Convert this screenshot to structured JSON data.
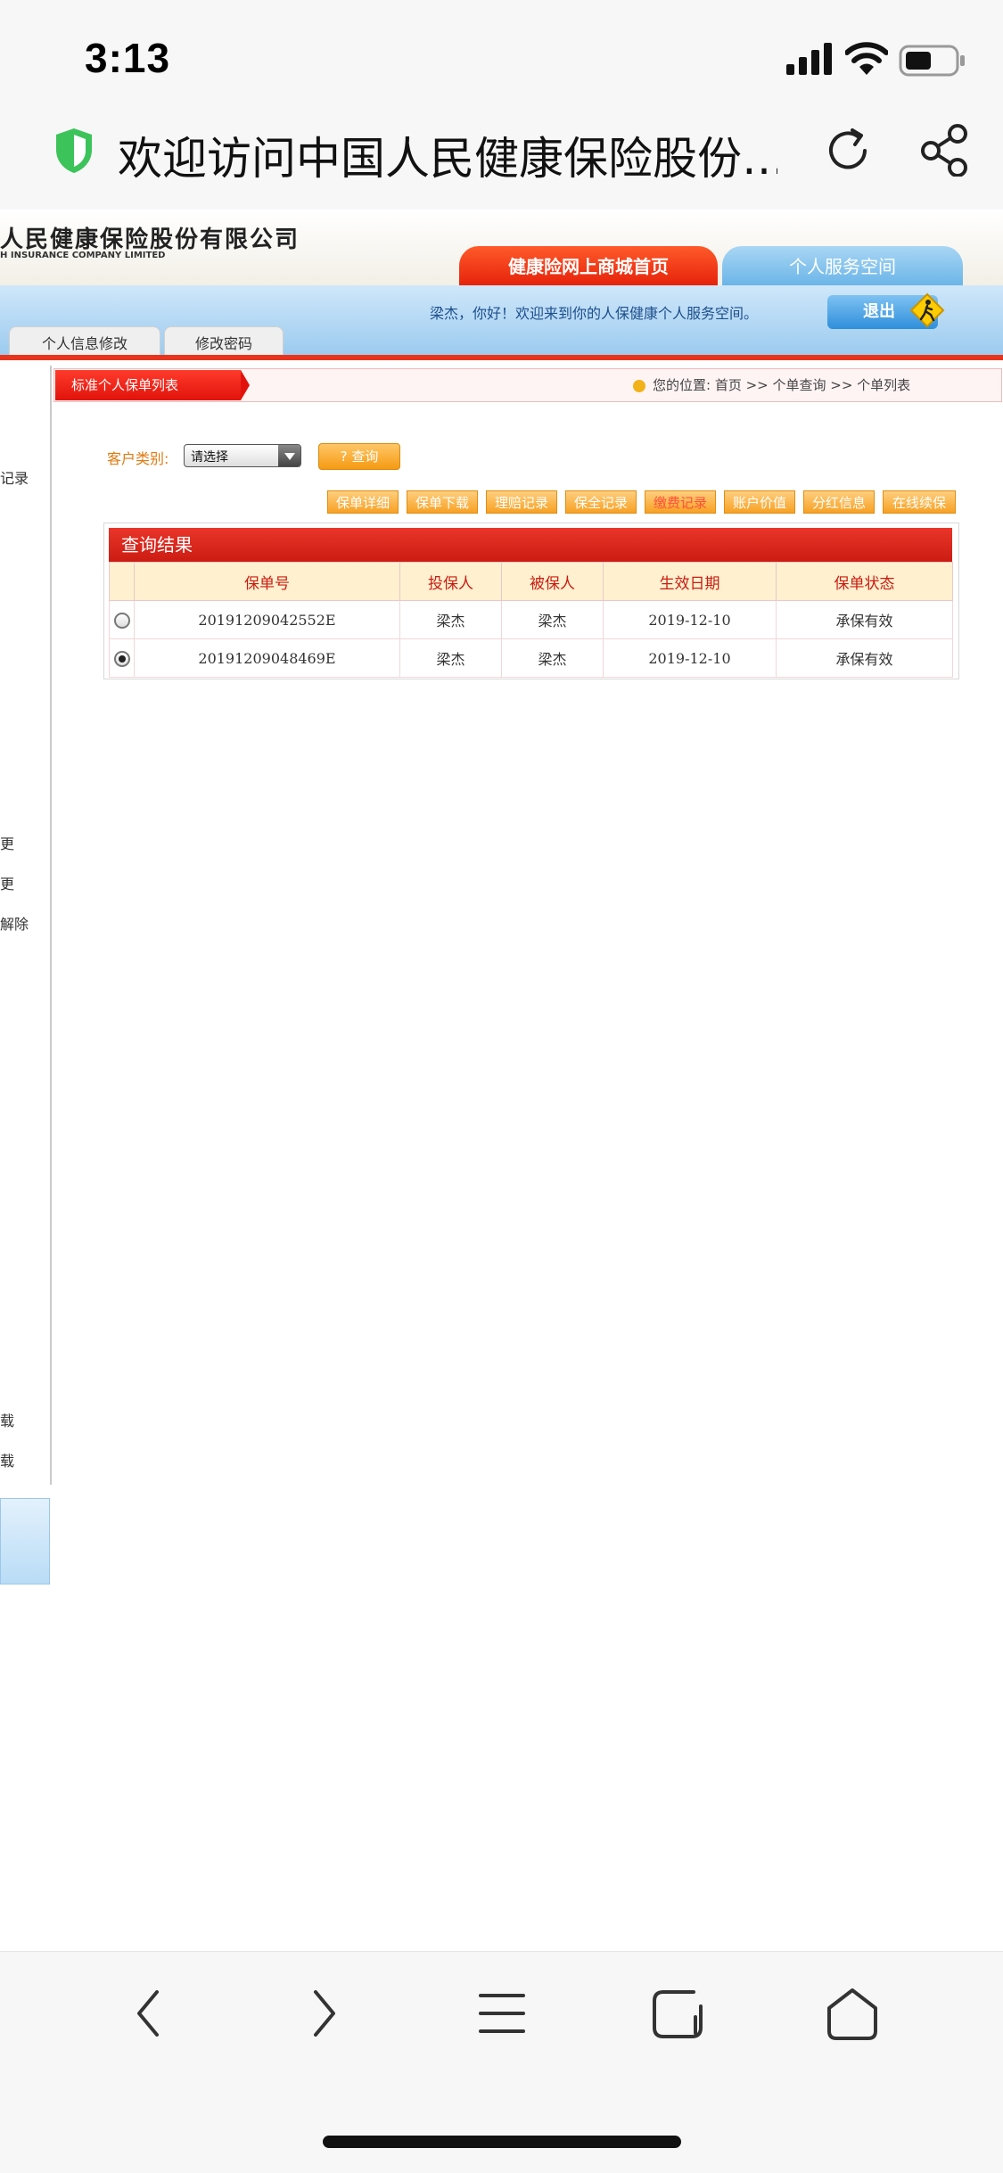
{
  "status_bar": {
    "time": "3:13"
  },
  "browser": {
    "title": "欢迎访问中国人民健康保险股份…"
  },
  "header": {
    "logo_cn": "人民健康保险股份有限公司",
    "logo_en": "H INSURANCE COMPANY LIMITED",
    "tab_mall": "健康险网上商城首页",
    "tab_personal": "个人服务空间",
    "welcome": "梁杰，你好！欢迎来到你的人保健康个人服务空间。",
    "logout": "退出",
    "tab_info": "个人信息修改",
    "tab_pwd": "修改密码"
  },
  "sidebar": {
    "items": [
      "记录",
      "更",
      "更",
      "解除",
      "载",
      "载"
    ]
  },
  "breadcrumb": {
    "tab": "标准个人保单列表",
    "text": "您的位置:  首页 >> 个单查询 >> 个单列表"
  },
  "filter": {
    "label": "客户类别:",
    "select_value": "请选择",
    "query_button": "? 查询"
  },
  "actions": [
    "保单详细",
    "保单下载",
    "理赔记录",
    "保全记录",
    "缴费记录",
    "账户价值",
    "分红信息",
    "在线续保"
  ],
  "result": {
    "title": "查询结果",
    "columns": [
      "保单号",
      "投保人",
      "被保人",
      "生效日期",
      "保单状态"
    ],
    "rows": [
      {
        "policy_no": "20191209042552E",
        "applicant": "梁杰",
        "insured": "梁杰",
        "date": "2019-12-10",
        "status": "承保有效",
        "selected": false
      },
      {
        "policy_no": "20191209048469E",
        "applicant": "梁杰",
        "insured": "梁杰",
        "date": "2019-12-10",
        "status": "承保有效",
        "selected": true
      }
    ]
  },
  "icons": {
    "shield": "shield-icon",
    "reload": "reload-icon",
    "share": "share-icon",
    "back": "back-icon",
    "forward": "forward-icon",
    "menu": "menu-icon",
    "tabs": "tabs-icon",
    "home": "home-icon"
  },
  "colors": {
    "brand_red": "#e1130c",
    "brand_orange": "#f7a124",
    "accent_blue": "#6bb5e8"
  }
}
